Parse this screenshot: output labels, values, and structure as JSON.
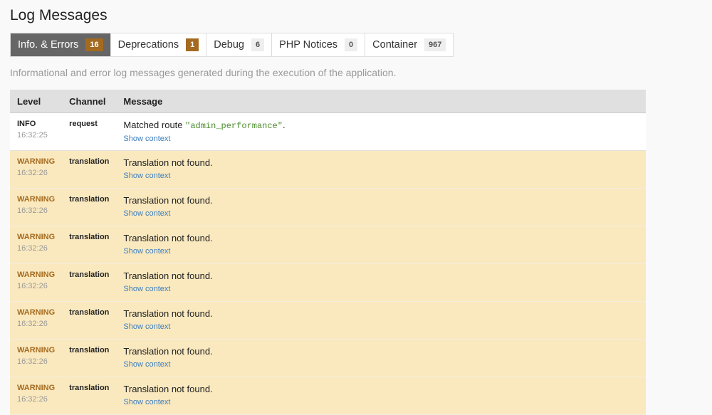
{
  "title": "Log Messages",
  "tabs": [
    {
      "label": "Info. & Errors",
      "count": "16"
    },
    {
      "label": "Deprecations",
      "count": "1"
    },
    {
      "label": "Debug",
      "count": "6"
    },
    {
      "label": "PHP Notices",
      "count": "0"
    },
    {
      "label": "Container",
      "count": "967"
    }
  ],
  "description": "Informational and error log messages generated during the execution of the application.",
  "columns": {
    "level": "Level",
    "channel": "Channel",
    "message": "Message"
  },
  "rows": [
    {
      "level": "INFO",
      "time": "16:32:25",
      "channel": "request",
      "message_prefix": "Matched route ",
      "route": "\"admin_performance\"",
      "message_suffix": ".",
      "context": "Show context"
    },
    {
      "level": "WARNING",
      "time": "16:32:26",
      "channel": "translation",
      "message": "Translation not found.",
      "context": "Show context"
    },
    {
      "level": "WARNING",
      "time": "16:32:26",
      "channel": "translation",
      "message": "Translation not found.",
      "context": "Show context"
    },
    {
      "level": "WARNING",
      "time": "16:32:26",
      "channel": "translation",
      "message": "Translation not found.",
      "context": "Show context"
    },
    {
      "level": "WARNING",
      "time": "16:32:26",
      "channel": "translation",
      "message": "Translation not found.",
      "context": "Show context"
    },
    {
      "level": "WARNING",
      "time": "16:32:26",
      "channel": "translation",
      "message": "Translation not found.",
      "context": "Show context"
    },
    {
      "level": "WARNING",
      "time": "16:32:26",
      "channel": "translation",
      "message": "Translation not found.",
      "context": "Show context"
    },
    {
      "level": "WARNING",
      "time": "16:32:26",
      "channel": "translation",
      "message": "Translation not found.",
      "context": "Show context"
    }
  ]
}
